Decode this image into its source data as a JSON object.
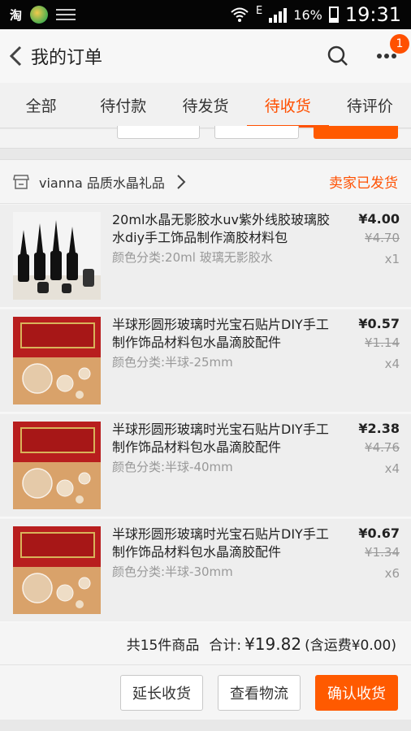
{
  "status_bar": {
    "app_icon_text": "淘",
    "network": "E",
    "battery_pct": "16%",
    "time": "19:31"
  },
  "app_bar": {
    "title": "我的订单",
    "badge_count": "1",
    "icons": {
      "back": "back-icon",
      "search": "search-icon",
      "more": "more-icon"
    }
  },
  "tabs": [
    {
      "label": "全部",
      "active": false
    },
    {
      "label": "待付款",
      "active": false
    },
    {
      "label": "待发货",
      "active": false
    },
    {
      "label": "待收货",
      "active": true
    },
    {
      "label": "待评价",
      "active": false
    }
  ],
  "order": {
    "shop_name": "vianna 品质水晶礼品",
    "status": "卖家已发货",
    "items": [
      {
        "title": "20ml水晶无影胶水uv紫外线胶玻璃胶水diy手工饰品制作滴胶材料包",
        "spec": "颜色分类:20ml 玻璃无影胶水",
        "price": "¥4.00",
        "original_price": "¥4.70",
        "qty": "x1"
      },
      {
        "title": "半球形圆形玻璃时光宝石贴片DIY手工制作饰品材料包水晶滴胶配件",
        "spec": "颜色分类:半球-25mm",
        "price": "¥0.57",
        "original_price": "¥1.14",
        "qty": "x4"
      },
      {
        "title": "半球形圆形玻璃时光宝石贴片DIY手工制作饰品材料包水晶滴胶配件",
        "spec": "颜色分类:半球-40mm",
        "price": "¥2.38",
        "original_price": "¥4.76",
        "qty": "x4"
      },
      {
        "title": "半球形圆形玻璃时光宝石贴片DIY手工制作饰品材料包水晶滴胶配件",
        "spec": "颜色分类:半球-30mm",
        "price": "¥0.67",
        "original_price": "¥1.34",
        "qty": "x6"
      }
    ],
    "summary": {
      "count_text": "共15件商品",
      "total_label": "合计:",
      "total": "¥19.82",
      "shipping": "(含运费¥0.00)"
    },
    "buttons": {
      "extend": "延长收货",
      "logistics": "查看物流",
      "confirm": "确认收货"
    }
  },
  "colors": {
    "accent": "#ff5000",
    "background": "#e8e8e8"
  }
}
